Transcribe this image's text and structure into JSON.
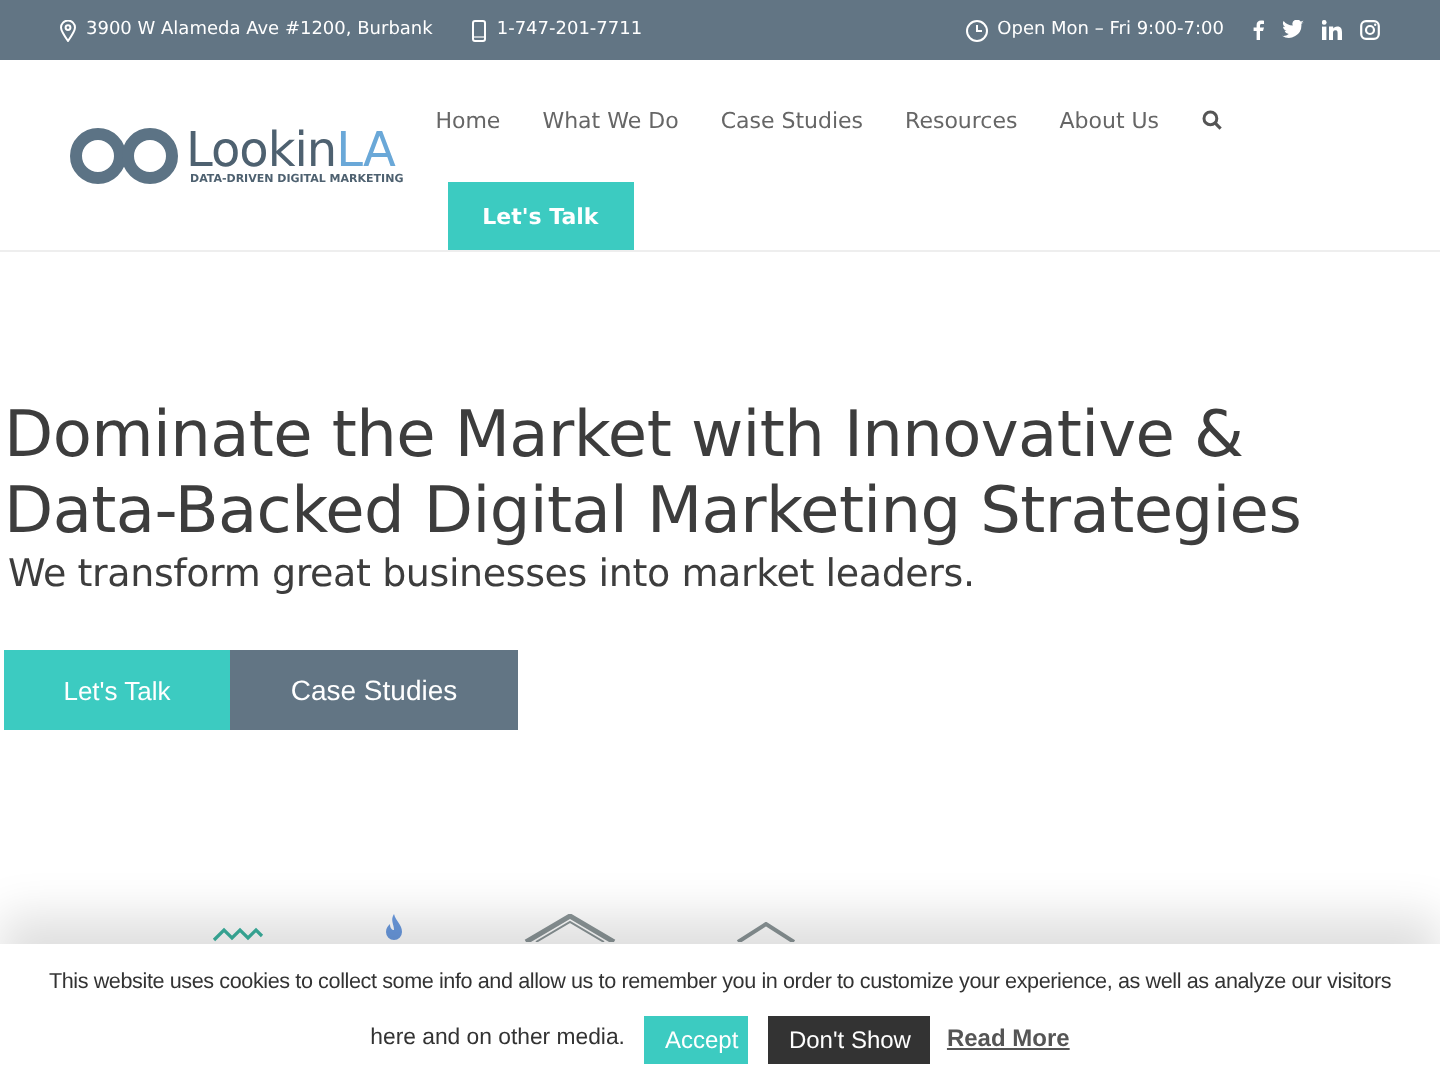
{
  "top_bar": {
    "address": "3900 W Alameda Ave #1200, Burbank",
    "phone": "1-747-201-7711",
    "hours": "Open Mon – Fri 9:00-7:00"
  },
  "logo": {
    "name": "Lookin",
    "name_accent": "LA",
    "tagline": "DATA-DRIVEN DIGITAL MARKETING"
  },
  "nav": {
    "items": [
      "Home",
      "What We Do",
      "Case Studies",
      "Resources",
      "About Us"
    ],
    "cta": "Let's Talk"
  },
  "hero": {
    "headline": "Dominate the Market with Innovative & Data-Backed Digital Marketing Strategies",
    "subheadline": "We transform great businesses into market leaders.",
    "buttons": [
      {
        "label": "Let's Talk",
        "kind": "primary"
      },
      {
        "label": "Case Studies",
        "kind": "secondary"
      }
    ]
  },
  "cookie_bar": {
    "message_lines": [
      "This website uses cookies to collect some info and allow us to remember you in order to customize your experience, as well as analyze our visitors",
      "here and on other media."
    ],
    "accept": "Accept",
    "decline": "Don't Show",
    "read_more": "Read More"
  }
}
